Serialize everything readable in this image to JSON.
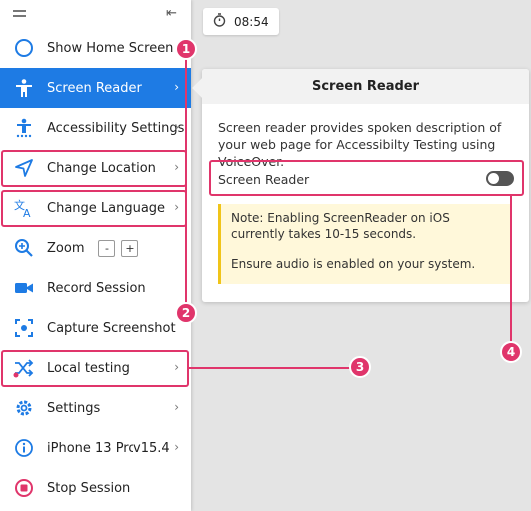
{
  "timer": {
    "time": "08:54"
  },
  "sidebar": {
    "items": [
      {
        "label": "Show Home Screen",
        "icon": "circle-icon"
      },
      {
        "label": "Screen Reader",
        "icon": "accessibility-person-icon",
        "active": true
      },
      {
        "label": "Accessibility Settings",
        "icon": "accessibility-settings-icon"
      },
      {
        "label": "Change Location",
        "icon": "location-arrow-icon"
      },
      {
        "label": "Change Language",
        "icon": "translate-icon"
      },
      {
        "label": "Zoom",
        "icon": "zoom-icon",
        "zoom_minus": "-",
        "zoom_plus": "+"
      },
      {
        "label": "Record Session",
        "icon": "video-camera-icon"
      },
      {
        "label": "Capture Screenshot",
        "icon": "screenshot-icon"
      },
      {
        "label": "Local testing",
        "icon": "shuffle-icon"
      },
      {
        "label": "Settings",
        "icon": "gear-icon"
      },
      {
        "label": "iPhone 13 Pro",
        "version": "v15.4",
        "icon": "info-icon"
      },
      {
        "label": "Stop Session",
        "icon": "stop-icon"
      }
    ]
  },
  "popover": {
    "title": "Screen Reader",
    "description": "Screen reader provides spoken description of your web page for Accessibilty Testing using VoiceOver.",
    "toggle_label": "Screen Reader",
    "toggle_on": false,
    "note_line1": "Note: Enabling ScreenReader on iOS currently takes 10-15 seconds.",
    "note_line2": "Ensure audio is enabled on your system."
  },
  "annotations": [
    "1",
    "2",
    "3",
    "4"
  ],
  "colors": {
    "accent": "#1e7be4",
    "highlight": "#e0356b",
    "note_border": "#f0c419"
  }
}
